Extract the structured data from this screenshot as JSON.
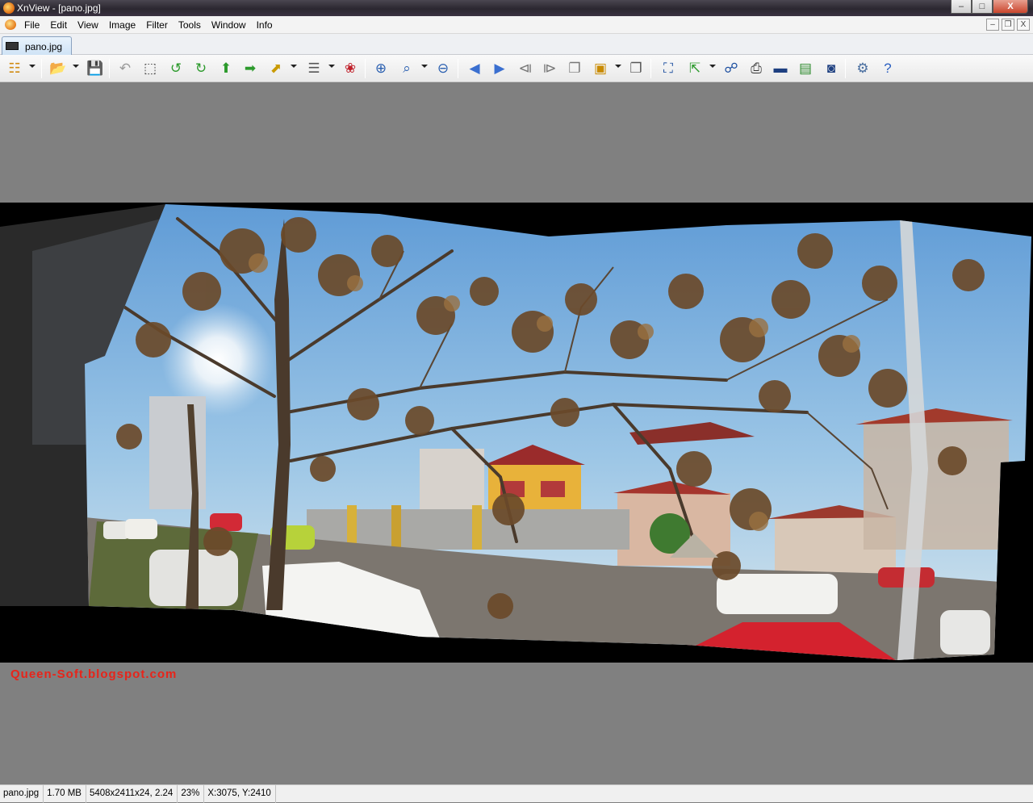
{
  "window": {
    "title": "XnView - [pano.jpg]",
    "controls": [
      "–",
      "□",
      "X"
    ]
  },
  "menubar": {
    "items": [
      {
        "label": "File",
        "mnemonic": "F"
      },
      {
        "label": "Edit",
        "mnemonic": "E"
      },
      {
        "label": "View",
        "mnemonic": "V"
      },
      {
        "label": "Image",
        "mnemonic": "I"
      },
      {
        "label": "Filter",
        "mnemonic": "F"
      },
      {
        "label": "Tools",
        "mnemonic": "T"
      },
      {
        "label": "Window",
        "mnemonic": "W"
      },
      {
        "label": "Info",
        "mnemonic": "I"
      }
    ],
    "mdi_controls": [
      "–",
      "❐",
      "X"
    ]
  },
  "tab": {
    "label": "pano.jpg"
  },
  "toolbar": {
    "buttons": [
      {
        "name": "browser-icon",
        "glyph": "☷",
        "color": "#d08a10",
        "dropdown": true
      },
      {
        "name": "open-folder-icon",
        "glyph": "📂",
        "color": "#c9a000",
        "dropdown": true
      },
      {
        "name": "save-icon",
        "glyph": "💾",
        "color": "#2a6fb8",
        "dropdown": false
      },
      {
        "name": "undo-icon",
        "glyph": "↶",
        "color": "#9a9a9a",
        "dropdown": false
      },
      {
        "name": "crop-icon",
        "glyph": "⬚",
        "color": "#444444",
        "dropdown": false
      },
      {
        "name": "rotate-left-icon",
        "glyph": "↺",
        "color": "#2c9a2c",
        "dropdown": false
      },
      {
        "name": "rotate-right-icon",
        "glyph": "↻",
        "color": "#2c9a2c",
        "dropdown": false
      },
      {
        "name": "flip-up-icon",
        "glyph": "⬆",
        "color": "#2c9a2c",
        "dropdown": false
      },
      {
        "name": "flip-right-icon",
        "glyph": "➡",
        "color": "#2c9a2c",
        "dropdown": false
      },
      {
        "name": "transform-icon",
        "glyph": "⬈",
        "color": "#c99a00",
        "dropdown": true
      },
      {
        "name": "adjust-icon",
        "glyph": "☰",
        "color": "#555555",
        "dropdown": true
      },
      {
        "name": "red-eye-icon",
        "glyph": "❀",
        "color": "#c0202a",
        "dropdown": false
      },
      {
        "name": "zoom-in-icon",
        "glyph": "⊕",
        "color": "#2a5fb0",
        "dropdown": false
      },
      {
        "name": "zoom-icon",
        "glyph": "⌕",
        "color": "#2a5fb0",
        "dropdown": true
      },
      {
        "name": "zoom-out-icon",
        "glyph": "⊖",
        "color": "#2a5fb0",
        "dropdown": false
      },
      {
        "name": "previous-icon",
        "glyph": "◀",
        "color": "#3a6fd0",
        "dropdown": false
      },
      {
        "name": "next-icon",
        "glyph": "▶",
        "color": "#3a6fd0",
        "dropdown": false
      },
      {
        "name": "first-icon",
        "glyph": "⧏",
        "color": "#777777",
        "dropdown": false
      },
      {
        "name": "last-icon",
        "glyph": "⧐",
        "color": "#777777",
        "dropdown": false
      },
      {
        "name": "copy-icon",
        "glyph": "❐",
        "color": "#777777",
        "dropdown": false
      },
      {
        "name": "slideshow-icon",
        "glyph": "▣",
        "color": "#c98a00",
        "dropdown": true
      },
      {
        "name": "capture-icon",
        "glyph": "❐",
        "color": "#555555",
        "dropdown": false
      },
      {
        "name": "fullscreen-icon",
        "glyph": "⛶",
        "color": "#1d4fa0",
        "dropdown": false
      },
      {
        "name": "export-icon",
        "glyph": "⇱",
        "color": "#2c9a2c",
        "dropdown": true
      },
      {
        "name": "find-icon",
        "glyph": "☍",
        "color": "#1d4fa0",
        "dropdown": false
      },
      {
        "name": "print-icon",
        "glyph": "⎙",
        "color": "#333333",
        "dropdown": false
      },
      {
        "name": "scan-icon",
        "glyph": "▬",
        "color": "#1d3f80",
        "dropdown": false
      },
      {
        "name": "wallpaper-icon",
        "glyph": "▤",
        "color": "#2c8a2c",
        "dropdown": false
      },
      {
        "name": "camera-icon",
        "glyph": "◙",
        "color": "#1d3f80",
        "dropdown": false
      },
      {
        "name": "settings-icon",
        "glyph": "⚙",
        "color": "#4a6fa0",
        "dropdown": false
      },
      {
        "name": "help-icon",
        "glyph": "?",
        "color": "#2a5fc0",
        "dropdown": false
      }
    ]
  },
  "watermark": "Queen-Soft.blogspot.com",
  "statusbar": {
    "filename": "pano.jpg",
    "filesize": "1.70 MB",
    "dimensions": "5408x2411x24, 2.24",
    "zoom": "23%",
    "cursor": "X:3075, Y:2410"
  },
  "colors": {
    "sky_top": "#6fa7dd",
    "sky_bottom": "#cfe3ef",
    "ground": "#7a7068",
    "watermark": "#e8241a"
  }
}
